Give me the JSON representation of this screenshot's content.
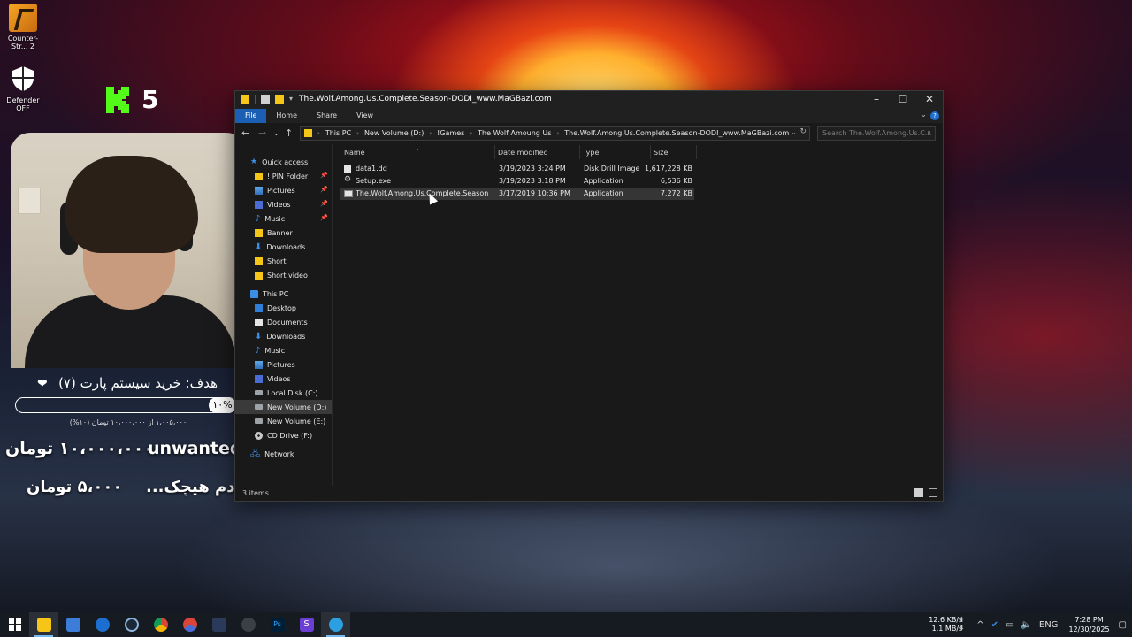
{
  "desktop": {
    "icons": [
      {
        "label": "Counter-Str... 2"
      },
      {
        "label": "Defender OFF"
      }
    ]
  },
  "overlay": {
    "kick_count": "5",
    "goal_title": "هدف: خرید سیستم پارت (۷)",
    "goal_percent": "۱۰%",
    "goal_progress": 0.1,
    "goal_sub": "۱،۰۰۵،۰۰۰ از ۱۰،۰۰۰،۰۰۰ تومان (۱۰%)",
    "donations": [
      {
        "name": "unwanted...",
        "amount": "۱۰،۰۰۰،۰۰۰ تومان"
      },
      {
        "name": "آدم هیچک...",
        "amount": "۵،۰۰۰ تومان"
      }
    ]
  },
  "explorer": {
    "title": "The.Wolf.Among.Us.Complete.Season-DODI_www.MaGBazi.com",
    "ribbon_tabs": [
      "File",
      "Home",
      "Share",
      "View"
    ],
    "breadcrumb": [
      "This PC",
      "New Volume (D:)",
      "!Games",
      "The Wolf Amoung Us",
      "The.Wolf.Among.Us.Complete.Season-DODI_www.MaGBazi.com"
    ],
    "search_placeholder": "Search The.Wolf.Among.Us.C...",
    "nav": {
      "quick_access": "Quick access",
      "quick_items": [
        {
          "label": "! PIN Folder",
          "pinned": true
        },
        {
          "label": "Pictures",
          "pinned": true
        },
        {
          "label": "Videos",
          "pinned": true
        },
        {
          "label": "Music",
          "pinned": true
        },
        {
          "label": "Banner",
          "pinned": false
        },
        {
          "label": "Downloads",
          "pinned": false
        },
        {
          "label": "Short",
          "pinned": false
        },
        {
          "label": "Short video",
          "pinned": false
        }
      ],
      "this_pc": "This PC",
      "pc_items": [
        "Desktop",
        "Documents",
        "Downloads",
        "Music",
        "Pictures",
        "Videos",
        "Local Disk (C:)",
        "New Volume (D:)",
        "New Volume (E:)",
        "CD Drive (F:)"
      ],
      "network": "Network"
    },
    "columns": [
      "Name",
      "Date modified",
      "Type",
      "Size"
    ],
    "files": [
      {
        "name": "data1.dd",
        "date": "3/19/2023 3:24 PM",
        "type": "Disk Drill Image",
        "size": "1,617,228 KB"
      },
      {
        "name": "Setup.exe",
        "date": "3/19/2023 3:18 PM",
        "type": "Application",
        "size": "6,536 KB"
      },
      {
        "name": "The.Wolf.Among.Us.Complete.Season-D...",
        "date": "3/17/2019 10:36 PM",
        "type": "Application",
        "size": "7,272 KB"
      }
    ],
    "status": "3 items"
  },
  "taskbar": {
    "net_up": "12.6 KB/s",
    "net_down": "1.1 MB/s",
    "lang": "ENG",
    "time": "7:28 PM",
    "date": "12/30/2025"
  }
}
